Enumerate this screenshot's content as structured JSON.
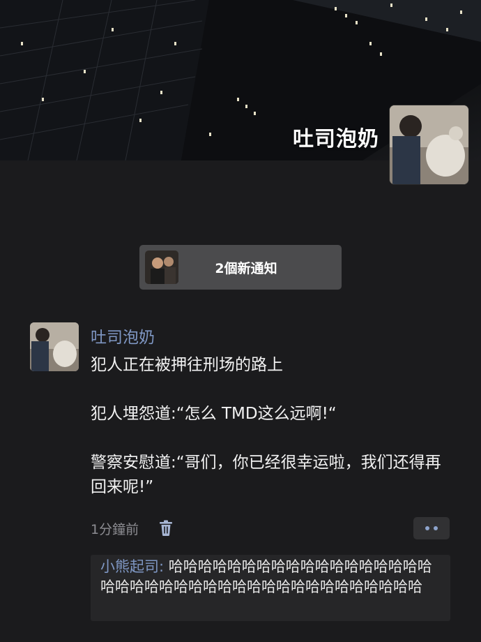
{
  "profile": {
    "name": "吐司泡奶",
    "avatar_icon": "profile-photo"
  },
  "notification": {
    "label": "2個新通知",
    "avatar_icon": "notification-sender-photo"
  },
  "post": {
    "author": "吐司泡奶",
    "body": "犯人正在被押往刑场的路上\n\n犯人埋怨道:“怎么 TMD这么远啊!“\n\n警察安慰道:“哥们，你已经很幸运啦，我们还得再回来呢!”",
    "time": "1分鐘前",
    "delete_icon": "trash-icon",
    "more_icon": "more-dots-icon"
  },
  "comments": [
    {
      "author": "小熊起司",
      "separator": ": ",
      "text": "哈哈哈哈哈哈哈哈哈哈哈哈哈哈哈哈哈哈哈哈哈哈哈哈哈哈哈哈哈哈哈哈哈哈哈哈哈哈哈哈"
    }
  ],
  "colors": {
    "background": "#1b1b1d",
    "link": "#7f97c4",
    "pill": "#4b4b4d",
    "comment_bg": "#262628"
  }
}
